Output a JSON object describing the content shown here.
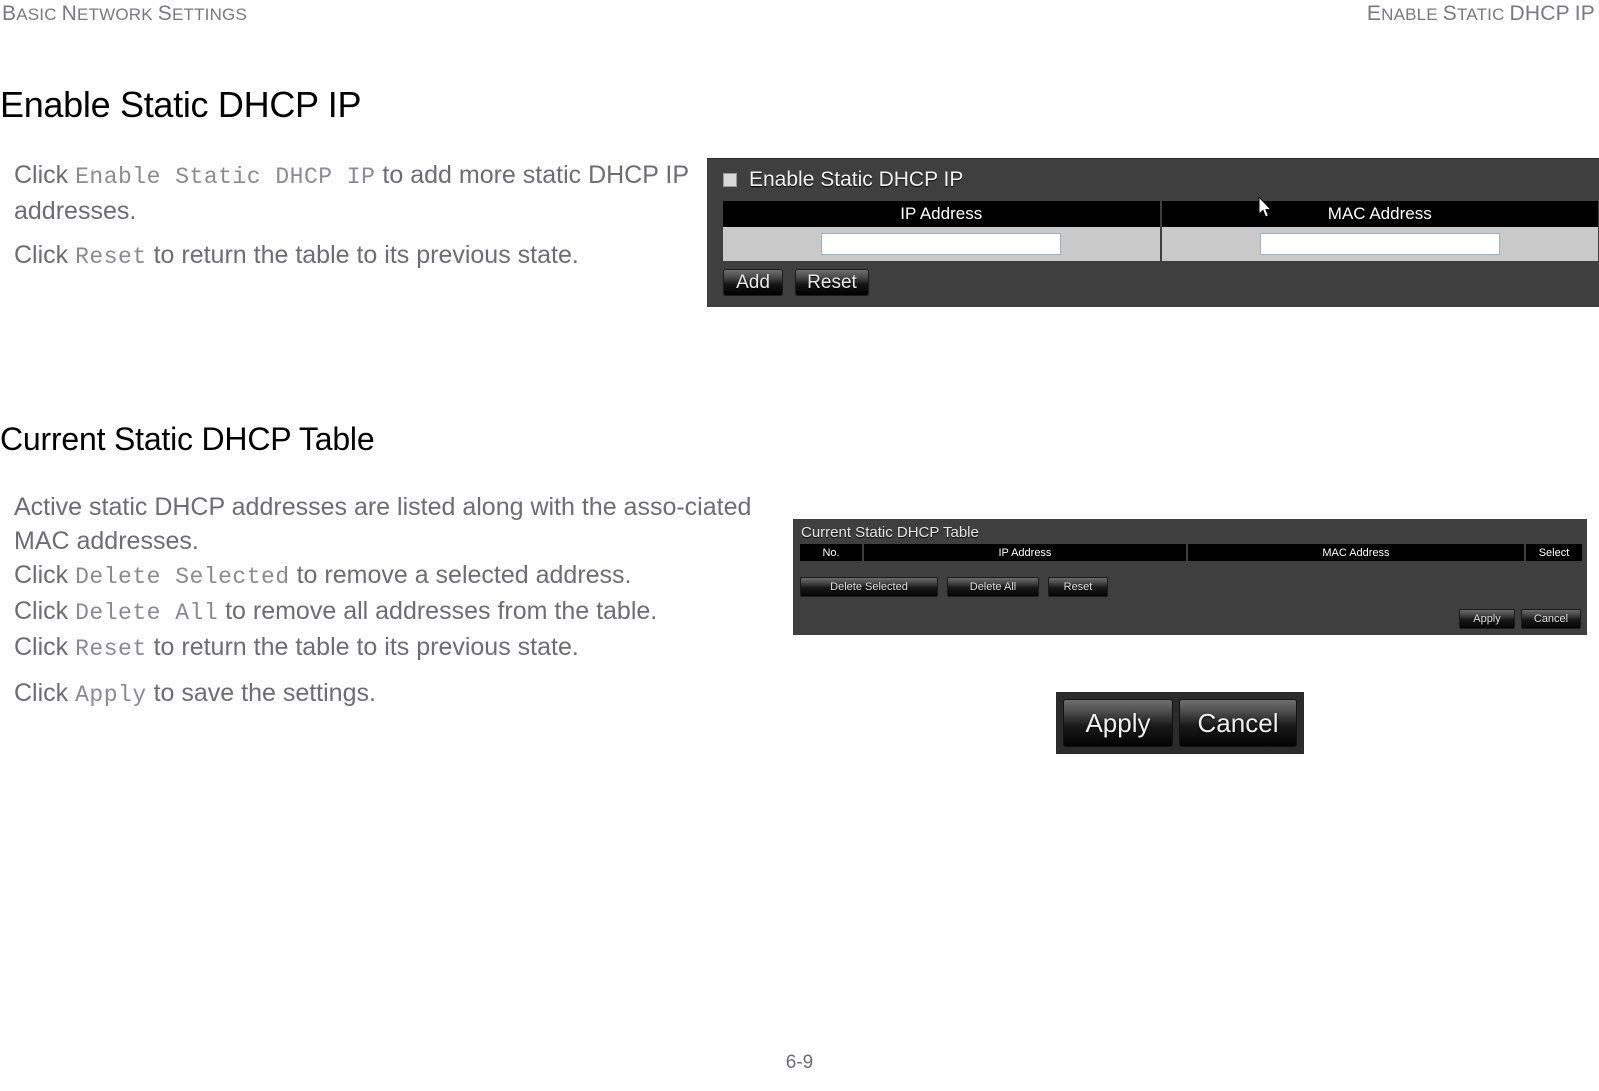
{
  "running_header": {
    "left": "Basic Network Settings",
    "right": "Enable Static DHCP IP"
  },
  "page_title": "Enable Static DHCP IP",
  "section_title": "Current Static DHCP Table",
  "paragraphs": {
    "p1_a": "Click ",
    "p1_code": "Enable Static DHCP IP",
    "p1_b": " to add more static DHCP IP addresses.",
    "p2_a": "Click ",
    "p2_code": "Reset",
    "p2_b": " to return the table to its previous state.",
    "p3_line1": "Active static DHCP addresses are listed along with the asso-ciated MAC addresses.",
    "p3_l2_a": "Click ",
    "p3_l2_code": "Delete Selected",
    "p3_l2_b": " to remove a selected address.",
    "p3_l3_a": "Click ",
    "p3_l3_code": "Delete All",
    "p3_l3_b": " to remove all addresses from the table.",
    "p3_l4_a": "Click ",
    "p3_l4_code": "Reset",
    "p3_l4_b": " to return the table to its previous state.",
    "p4_a": "Click ",
    "p4_code": "Apply",
    "p4_b": " to save the settings."
  },
  "screenshot_enable_static": {
    "checkbox_label": "Enable Static DHCP IP",
    "checkbox_checked": false,
    "columns": [
      "IP Address",
      "MAC Address"
    ],
    "inputs": {
      "ip_value": "",
      "mac_value": ""
    },
    "buttons": {
      "add": "Add",
      "reset": "Reset"
    }
  },
  "screenshot_current_table": {
    "title": "Current Static DHCP Table",
    "columns": [
      "No.",
      "IP Address",
      "MAC Address",
      "Select"
    ],
    "rows": [],
    "buttons": {
      "delete_selected": "Delete Selected",
      "delete_all": "Delete All",
      "reset": "Reset",
      "apply": "Apply",
      "cancel": "Cancel"
    }
  },
  "screenshot_apply_cancel": {
    "apply": "Apply",
    "cancel": "Cancel"
  },
  "footer": {
    "page_number": "6-9"
  },
  "colors": {
    "panel_bg": "#3f3f3f",
    "table_header_bg": "#000000",
    "table_row_bg": "#c9c9c9",
    "body_text": "#6e6e72",
    "code_text": "#8c8c90"
  }
}
